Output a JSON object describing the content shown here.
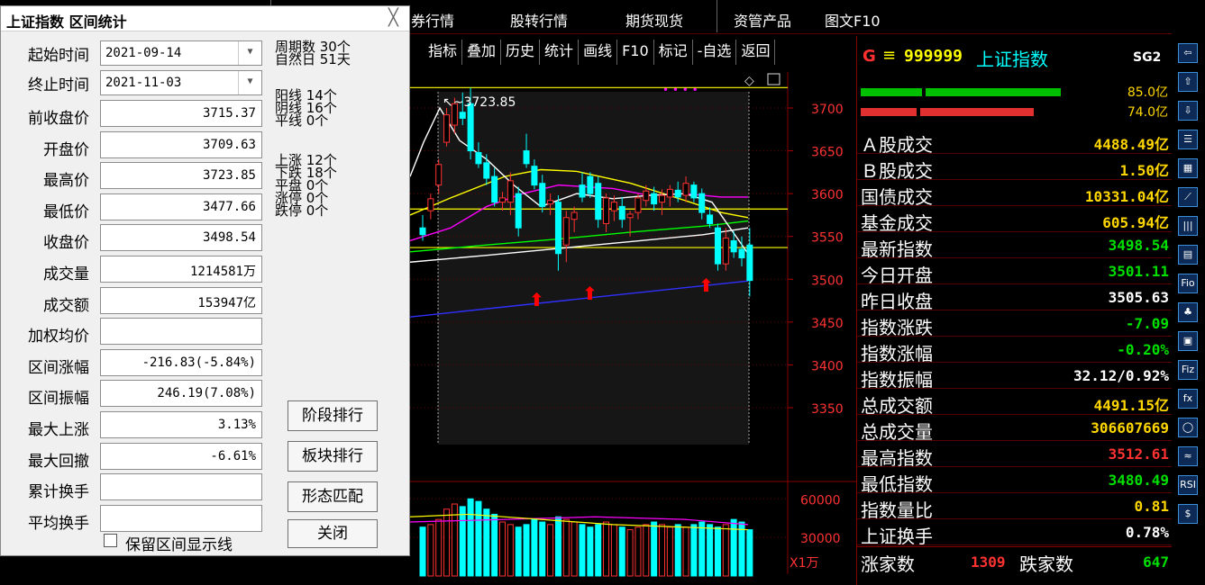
{
  "top_menu": {
    "items": [
      "券行情",
      "股转行情",
      "期货现货",
      "资管产品",
      "图文F10"
    ]
  },
  "toolbar": {
    "buttons": [
      "指标",
      "叠加",
      "历史",
      "统计",
      "画线",
      "F10",
      "标记",
      "-自选",
      "返回"
    ]
  },
  "chart": {
    "price_labels": [
      "3700",
      "3650",
      "3600",
      "3550",
      "3500",
      "3450",
      "3400",
      "3350"
    ],
    "volume_labels": [
      "60000",
      "30000"
    ],
    "volume_unit": "X1万",
    "high_annotation": "3723.85",
    "colors": {
      "up": "#ff3232",
      "down": "#00ffff",
      "ma_white": "#ffffff",
      "ma_yellow": "#ffff00",
      "ma_magenta": "#ff00ff",
      "ma_green": "#00ff00",
      "ma_blue": "#3030ff"
    },
    "candles": [
      {
        "o": 3560,
        "h": 3575,
        "l": 3545,
        "c": 3552
      },
      {
        "o": 3580,
        "h": 3600,
        "l": 3570,
        "c": 3594
      },
      {
        "o": 3610,
        "h": 3640,
        "l": 3600,
        "c": 3634
      },
      {
        "o": 3660,
        "h": 3700,
        "l": 3655,
        "c": 3692
      },
      {
        "o": 3680,
        "h": 3712,
        "l": 3670,
        "c": 3705
      },
      {
        "o": 3695,
        "h": 3718,
        "l": 3680,
        "c": 3688
      },
      {
        "o": 3705,
        "h": 3723.85,
        "l": 3640,
        "c": 3650
      },
      {
        "o": 3648,
        "h": 3660,
        "l": 3630,
        "c": 3635
      },
      {
        "o": 3636,
        "h": 3646,
        "l": 3610,
        "c": 3618
      },
      {
        "o": 3620,
        "h": 3630,
        "l": 3585,
        "c": 3590
      },
      {
        "o": 3590,
        "h": 3602,
        "l": 3580,
        "c": 3595
      },
      {
        "o": 3590,
        "h": 3625,
        "l": 3575,
        "c": 3615
      },
      {
        "o": 3600,
        "h": 3608,
        "l": 3550,
        "c": 3560
      },
      {
        "o": 3650,
        "h": 3670,
        "l": 3630,
        "c": 3635
      },
      {
        "o": 3632,
        "h": 3640,
        "l": 3605,
        "c": 3610
      },
      {
        "o": 3612,
        "h": 3622,
        "l": 3578,
        "c": 3585
      },
      {
        "o": 3588,
        "h": 3600,
        "l": 3575,
        "c": 3592
      },
      {
        "o": 3590,
        "h": 3598,
        "l": 3510,
        "c": 3530
      },
      {
        "o": 3540,
        "h": 3580,
        "l": 3520,
        "c": 3572
      },
      {
        "o": 3570,
        "h": 3585,
        "l": 3555,
        "c": 3578
      },
      {
        "o": 3610,
        "h": 3625,
        "l": 3590,
        "c": 3596
      },
      {
        "o": 3620,
        "h": 3625,
        "l": 3595,
        "c": 3600
      },
      {
        "o": 3612,
        "h": 3620,
        "l": 3560,
        "c": 3570
      },
      {
        "o": 3565,
        "h": 3600,
        "l": 3555,
        "c": 3595
      },
      {
        "o": 3580,
        "h": 3598,
        "l": 3568,
        "c": 3590
      },
      {
        "o": 3585,
        "h": 3596,
        "l": 3560,
        "c": 3570
      },
      {
        "o": 3572,
        "h": 3580,
        "l": 3550,
        "c": 3576
      },
      {
        "o": 3578,
        "h": 3600,
        "l": 3570,
        "c": 3595
      },
      {
        "o": 3592,
        "h": 3610,
        "l": 3585,
        "c": 3603
      },
      {
        "o": 3600,
        "h": 3608,
        "l": 3580,
        "c": 3588
      },
      {
        "o": 3590,
        "h": 3605,
        "l": 3575,
        "c": 3598
      },
      {
        "o": 3596,
        "h": 3610,
        "l": 3585,
        "c": 3605
      },
      {
        "o": 3604,
        "h": 3614,
        "l": 3590,
        "c": 3596
      },
      {
        "o": 3598,
        "h": 3620,
        "l": 3590,
        "c": 3612
      },
      {
        "o": 3610,
        "h": 3614,
        "l": 3590,
        "c": 3595
      },
      {
        "o": 3600,
        "h": 3606,
        "l": 3570,
        "c": 3578
      },
      {
        "o": 3575,
        "h": 3584,
        "l": 3560,
        "c": 3565
      },
      {
        "o": 3560,
        "h": 3565,
        "l": 3510,
        "c": 3518
      },
      {
        "o": 3518,
        "h": 3560,
        "l": 3510,
        "c": 3548
      },
      {
        "o": 3545,
        "h": 3556,
        "l": 3525,
        "c": 3532
      },
      {
        "o": 3535,
        "h": 3550,
        "l": 3515,
        "c": 3525
      },
      {
        "o": 3540,
        "h": 3560,
        "l": 3480,
        "c": 3498.54
      }
    ],
    "volumes": [
      38,
      40,
      44,
      52,
      56,
      54,
      60,
      58,
      52,
      48,
      42,
      40,
      38,
      40,
      44,
      42,
      40,
      46,
      44,
      42,
      40,
      38,
      40,
      42,
      40,
      38,
      36,
      38,
      40,
      42,
      40,
      38,
      40,
      38,
      40,
      42,
      40,
      38,
      40,
      44,
      42,
      36
    ]
  },
  "quote": {
    "g_label": "G",
    "menu_glyph": "≡",
    "code": "999999",
    "name": "上证指数",
    "sg": "SG2",
    "buy_vol": "85.0亿",
    "sell_vol": "74.0亿",
    "rows": [
      {
        "label": "Ａ股成交",
        "value": "4488.49亿",
        "color": "#ffd700"
      },
      {
        "label": "Ｂ股成交",
        "value": "1.50亿",
        "color": "#ffd700"
      },
      {
        "label": "国债成交",
        "value": "10331.04亿",
        "color": "#ffd700"
      },
      {
        "label": "基金成交",
        "value": "605.94亿",
        "color": "#ffd700"
      },
      {
        "label": "最新指数",
        "value": "3498.54",
        "color": "#00e000"
      },
      {
        "label": "今日开盘",
        "value": "3501.11",
        "color": "#00e000"
      },
      {
        "label": "昨日收盘",
        "value": "3505.63",
        "color": "#ffffff"
      },
      {
        "label": "指数涨跌",
        "value": "-7.09",
        "color": "#00e000"
      },
      {
        "label": "指数涨幅",
        "value": "-0.20%",
        "color": "#00e000"
      },
      {
        "label": "指数振幅",
        "value": "32.12/0.92%",
        "color": "#ffffff"
      },
      {
        "label": "总成交额",
        "value": "4491.15亿",
        "color": "#ffd700"
      },
      {
        "label": "总成交量",
        "value": "306607669",
        "color": "#ffd700"
      },
      {
        "label": "最高指数",
        "value": "3512.61",
        "color": "#ff3232"
      },
      {
        "label": "最低指数",
        "value": "3480.49",
        "color": "#00e000"
      },
      {
        "label": "指数量比",
        "value": "0.81",
        "color": "#ffd700"
      },
      {
        "label": "上证换手",
        "value": "0.78%",
        "color": "#ffffff"
      }
    ],
    "up_label": "涨家数",
    "up_value": "1309",
    "down_label": "跌家数",
    "down_value": "647"
  },
  "icons": [
    "left-arrow-icon",
    "up-arrow-icon",
    "down-arrow-icon",
    "list-icon",
    "grid-icon",
    "line-chart-icon",
    "candle-icon",
    "f10-doc-icon",
    "fio-icon",
    "tree-icon",
    "bracket-icon",
    "fiz-icon",
    "fx-icon",
    "circle-icon",
    "wave-icon",
    "rsi-icon",
    "money-icon"
  ],
  "icon_texts": [
    "⇦",
    "⇧",
    "⇩",
    "☰",
    "▦",
    "⟋",
    "|||",
    "▤",
    "Fio",
    "♣",
    "▣",
    "Fiz",
    "fx",
    "◯",
    "≈",
    "RSI",
    "$"
  ],
  "dialog": {
    "title": "上证指数 区间统计",
    "close": "╳",
    "start_label": "起始时间",
    "start_value": "2021-09-14",
    "end_label": "终止时间",
    "end_value": "2021-11-03",
    "fields": [
      {
        "label": "前收盘价",
        "value": "3715.37"
      },
      {
        "label": "开盘价",
        "value": "3709.63"
      },
      {
        "label": "最高价",
        "value": "3723.85"
      },
      {
        "label": "最低价",
        "value": "3477.66"
      },
      {
        "label": "收盘价",
        "value": "3498.54"
      },
      {
        "label": "成交量",
        "value": "1214581万"
      },
      {
        "label": "成交额",
        "value": "153947亿"
      },
      {
        "label": "加权均价",
        "value": ""
      },
      {
        "label": "区间涨幅",
        "value": "-216.83(-5.84%)"
      },
      {
        "label": "区间振幅",
        "value": "246.19(7.08%)"
      },
      {
        "label": "最大上涨",
        "value": "3.13%"
      },
      {
        "label": "最大回撤",
        "value": "-6.61%"
      },
      {
        "label": "累计换手",
        "value": ""
      },
      {
        "label": "平均换手",
        "value": ""
      }
    ],
    "stats": [
      "周期数 30个",
      "自然日 51天",
      "阳线 14个",
      "阴线 16个",
      "平线 0个",
      "上涨 12个",
      "下跌 18个",
      "平盘 0个",
      "涨停 0个",
      "跌停 0个"
    ],
    "buttons": [
      "阶段排行",
      "板块排行",
      "形态匹配",
      "关闭"
    ],
    "checkbox_label": "保留区间显示线"
  }
}
